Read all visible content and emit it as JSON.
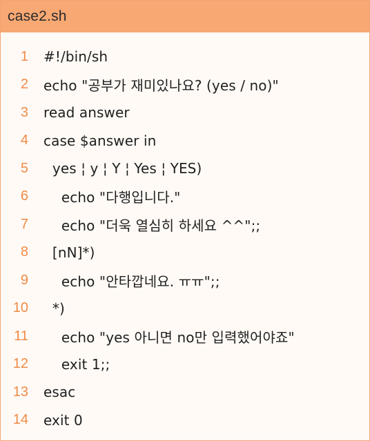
{
  "title": "case2.sh",
  "lines": [
    {
      "num": "1",
      "text": "#!/bin/sh"
    },
    {
      "num": "2",
      "text": "echo \"공부가 재미있나요? (yes / no)\""
    },
    {
      "num": "3",
      "text": "read answer"
    },
    {
      "num": "4",
      "text": "case $answer in"
    },
    {
      "num": "5",
      "text": "  yes ¦ y ¦ Y ¦ Yes ¦ YES)"
    },
    {
      "num": "6",
      "text": "    echo \"다행입니다.\""
    },
    {
      "num": "7",
      "text": "    echo \"더욱 열심히 하세요 ^^\";;"
    },
    {
      "num": "8",
      "text": "  [nN]*)"
    },
    {
      "num": "9",
      "text": "    echo \"안타깝네요. ㅠㅠ\";;"
    },
    {
      "num": "10",
      "text": "  *)"
    },
    {
      "num": "11",
      "text": "    echo \"yes 아니면 no만 입력했어야죠\""
    },
    {
      "num": "12",
      "text": "    exit 1;;"
    },
    {
      "num": "13",
      "text": "esac"
    },
    {
      "num": "14",
      "text": "exit 0"
    }
  ],
  "colors": {
    "header_bg": "#f7a873",
    "line_number": "#f08a45",
    "code_text": "#1f1f1f",
    "panel_bg": "#fffaf6"
  }
}
